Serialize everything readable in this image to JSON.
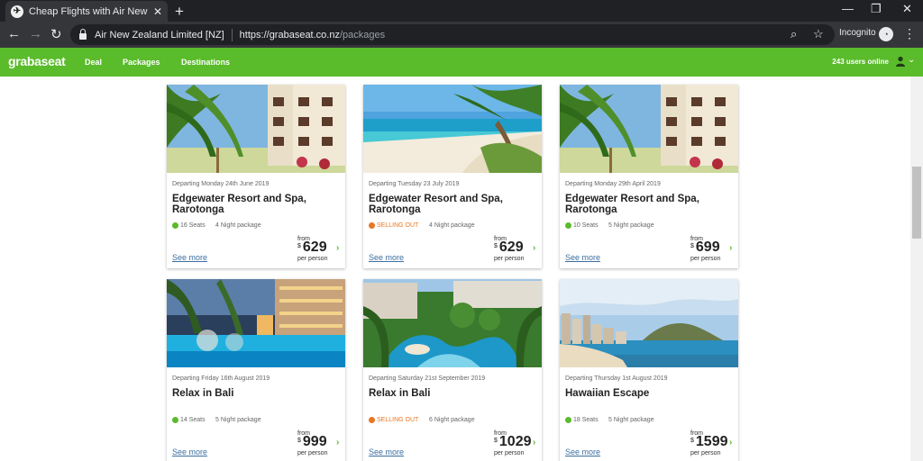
{
  "browser": {
    "tab_title": "Cheap Flights with Air New Zeala",
    "site_owner": "Air New Zealand Limited [NZ]",
    "url_host": "https://grabaseat.co.nz",
    "url_path": "/packages",
    "incognito_label": "Incognito"
  },
  "site": {
    "logo": "grabaseat",
    "nav": [
      "Deal",
      "Packages",
      "Destinations"
    ],
    "users_online": "243 users online",
    "accent_color": "#5abb2b"
  },
  "cards": [
    {
      "departing": "Departing Monday 24th June 2019",
      "title": "Edgewater Resort and Spa, Rarotonga",
      "status": "16 Seats",
      "status_type": "seats",
      "package": "4 Night package",
      "from": "from",
      "currency": "$",
      "price": "629",
      "per": "per person",
      "link": "See more",
      "photo": "palm-resort-hotel"
    },
    {
      "departing": "Departing Tuesday 23 July 2019",
      "title": "Edgewater Resort and Spa, Rarotonga",
      "status": "SELLING OUT",
      "status_type": "sellout",
      "package": "4 Night package",
      "from": "from",
      "currency": "$",
      "price": "629",
      "per": "per person",
      "link": "See more",
      "photo": "tropical-beach"
    },
    {
      "departing": "Departing Monday 29th April 2019",
      "title": "Edgewater Resort and Spa, Rarotonga",
      "status": "10 Seats",
      "status_type": "seats",
      "package": "5 Night package",
      "from": "from",
      "currency": "$",
      "price": "699",
      "per": "per person",
      "link": "See more",
      "photo": "palm-resort-hotel"
    },
    {
      "departing": "Departing Friday 16th August 2019",
      "title": "Relax in Bali",
      "status": "14 Seats",
      "status_type": "seats",
      "package": "5 Night package",
      "from": "from",
      "currency": "$",
      "price": "999",
      "per": "per person",
      "link": "See more",
      "photo": "resort-pool-evening"
    },
    {
      "departing": "Departing Saturday 21st September 2019",
      "title": "Relax in Bali",
      "status": "SELLING OUT",
      "status_type": "sellout",
      "package": "6 Night package",
      "from": "from",
      "currency": "$",
      "price": "1029",
      "per": "per person",
      "link": "See more",
      "photo": "lagoon-pool-aerial"
    },
    {
      "departing": "Departing Thursday 1st August 2019",
      "title": "Hawaiian Escape",
      "status": "18 Seats",
      "status_type": "seats",
      "package": "5 Night package",
      "from": "from",
      "currency": "$",
      "price": "1599",
      "per": "per person",
      "link": "See more",
      "photo": "waikiki-beach"
    }
  ],
  "colors": {
    "seats_dot": "#5abb2b",
    "sellout_dot": "#e87722",
    "link": "#3c6fa0"
  }
}
